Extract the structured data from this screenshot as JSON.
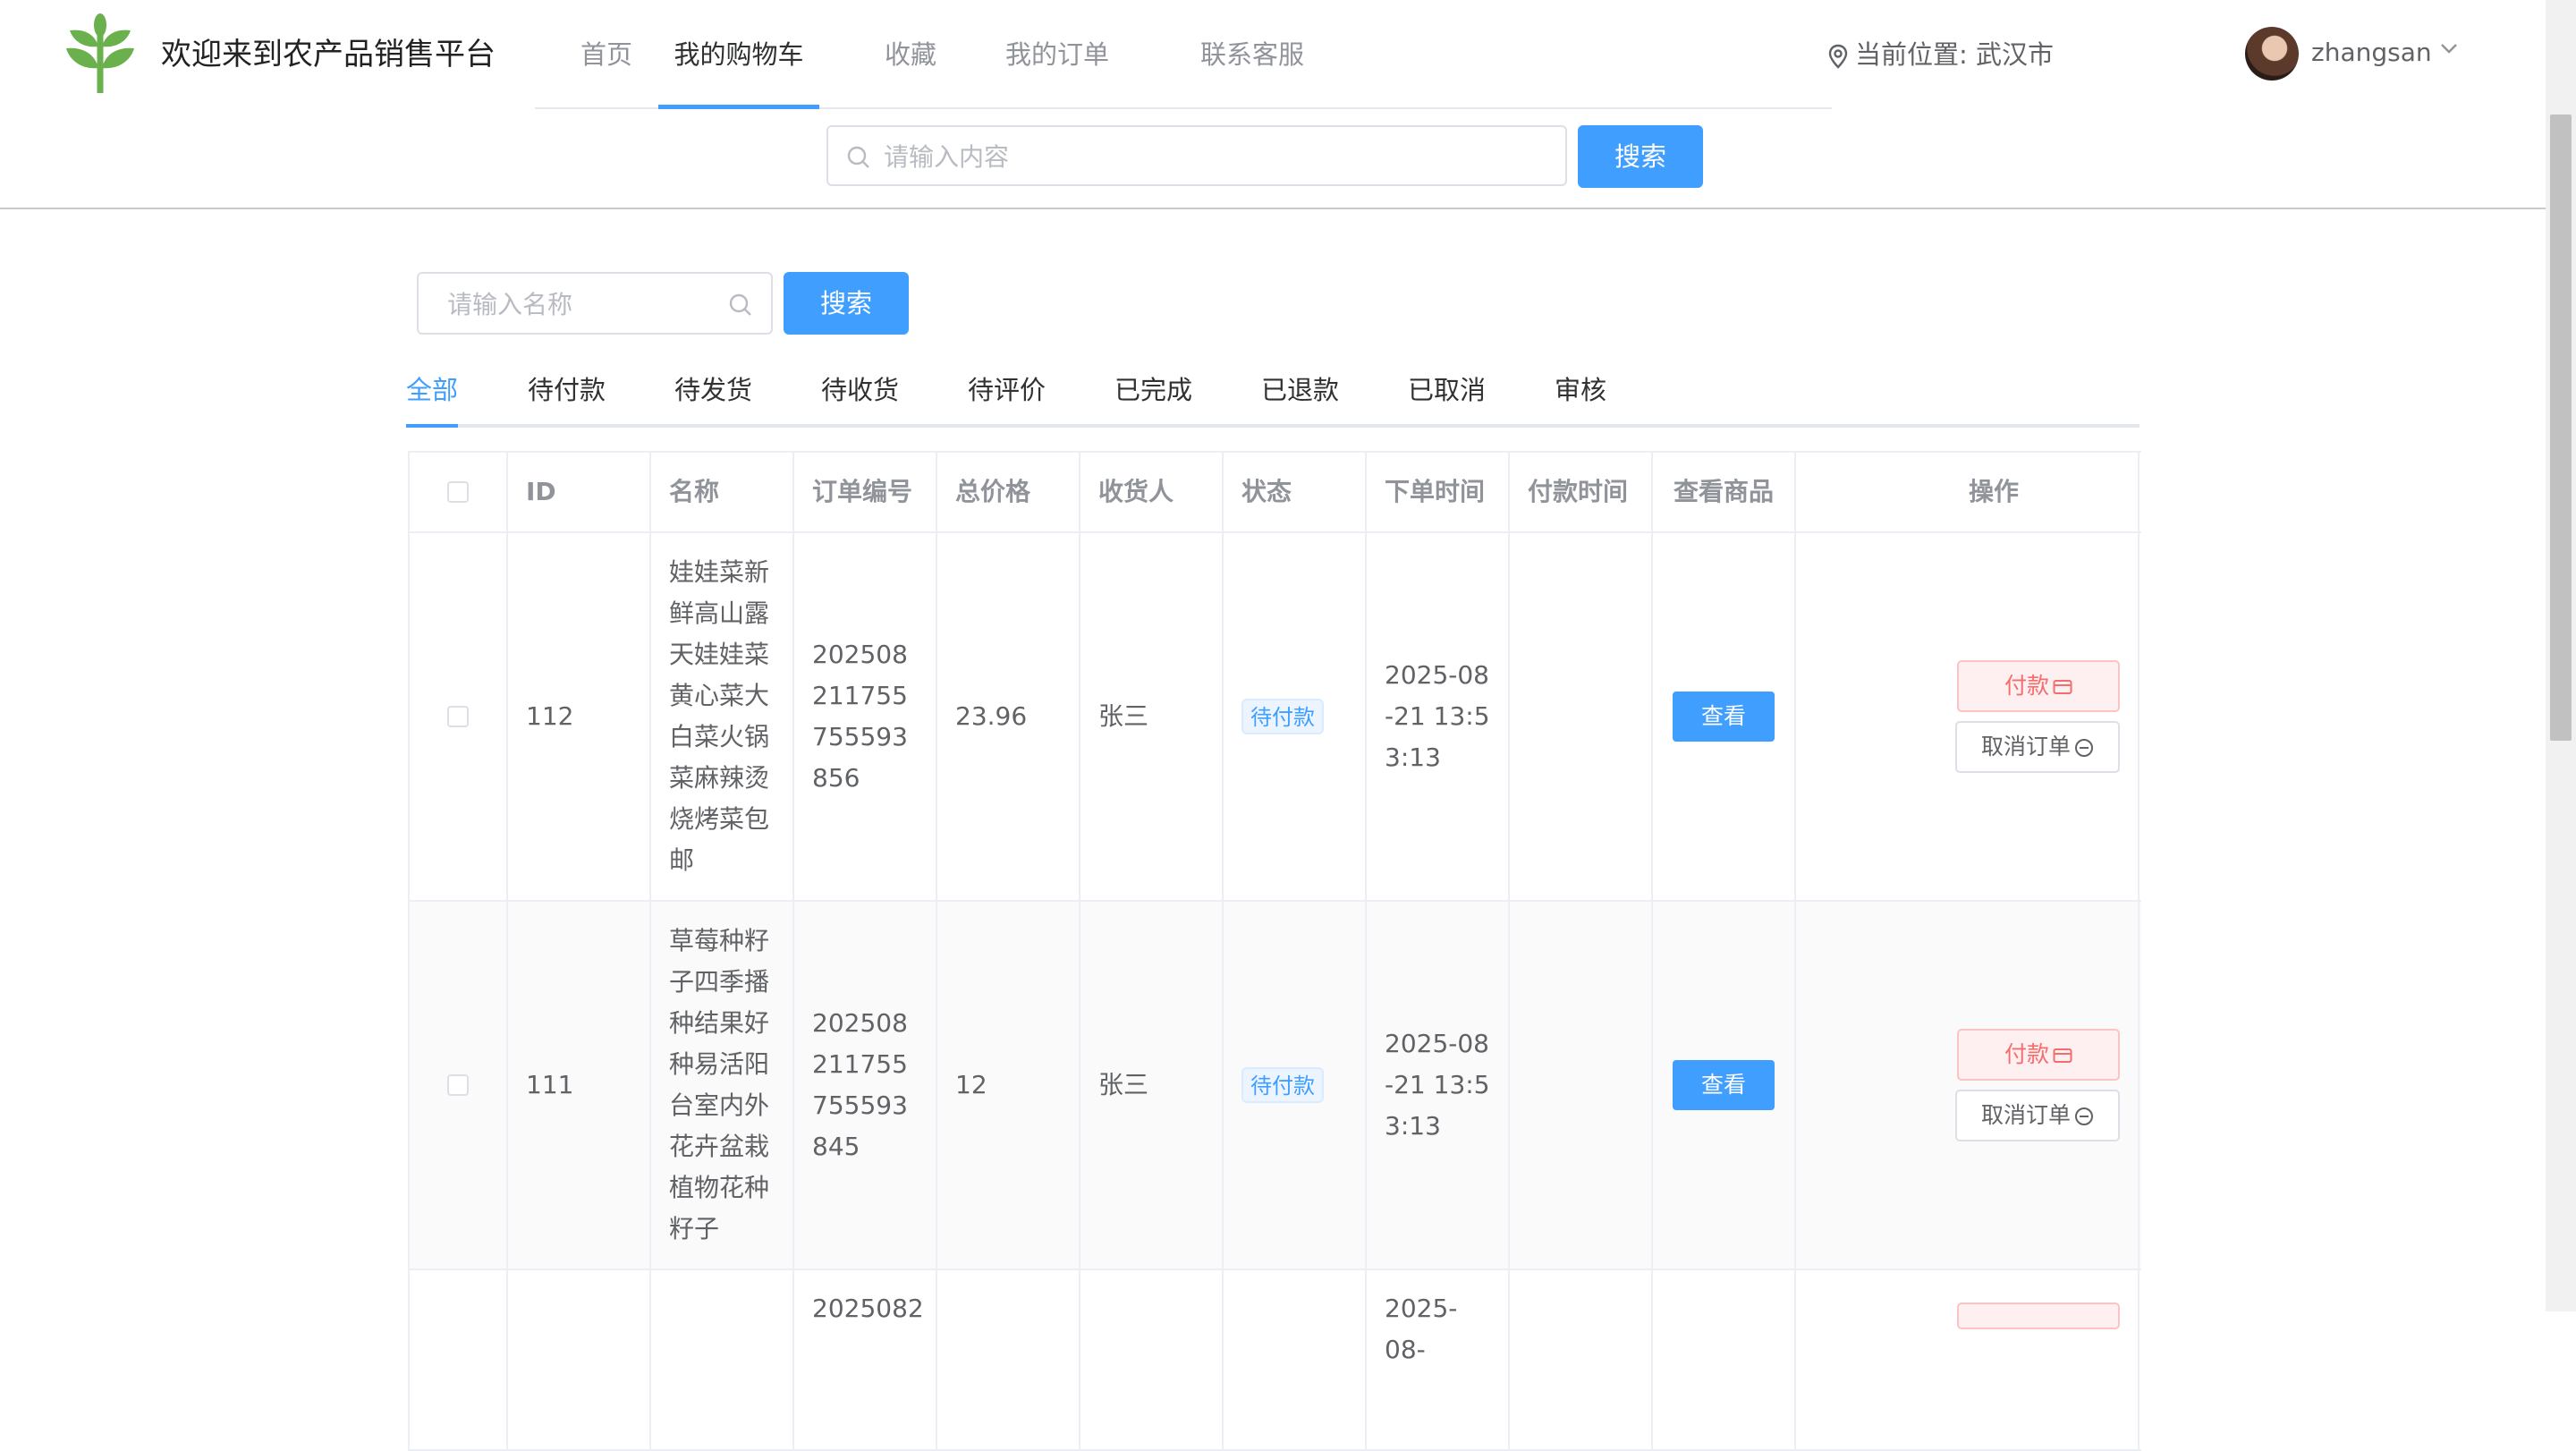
{
  "header": {
    "site_title": "欢迎来到农产品销售平台",
    "nav": [
      {
        "label": "首页",
        "active": false
      },
      {
        "label": "我的购物车",
        "active": true
      },
      {
        "label": "收藏",
        "active": false
      },
      {
        "label": "我的订单",
        "active": false
      },
      {
        "label": "联系客服",
        "active": false
      }
    ],
    "location_label": "当前位置: 武汉市",
    "username": "zhangsan",
    "search_placeholder": "请输入内容",
    "search_button": "搜索"
  },
  "filter": {
    "name_placeholder": "请输入名称",
    "search_button": "搜索"
  },
  "tabs": [
    {
      "label": "全部",
      "active": true
    },
    {
      "label": "待付款",
      "active": false
    },
    {
      "label": "待发货",
      "active": false
    },
    {
      "label": "待收货",
      "active": false
    },
    {
      "label": "待评价",
      "active": false
    },
    {
      "label": "已完成",
      "active": false
    },
    {
      "label": "已退款",
      "active": false
    },
    {
      "label": "已取消",
      "active": false
    },
    {
      "label": "审核",
      "active": false
    }
  ],
  "table": {
    "columns": [
      "ID",
      "名称",
      "订单编号",
      "总价格",
      "收货人",
      "状态",
      "下单时间",
      "付款时间",
      "查看商品",
      "操作"
    ],
    "rows": [
      {
        "id": "112",
        "name": "娃娃菜新鲜高山露天娃娃菜黄心菜大白菜火锅菜麻辣烫烧烤菜包邮",
        "order_no": "202508211755755593856",
        "total": "23.96",
        "receiver": "张三",
        "status": "待付款",
        "order_time": "2025-08-21 13:53:13",
        "pay_time": "",
        "view_label": "查看",
        "pay_label": "付款",
        "cancel_label": "取消订单"
      },
      {
        "id": "111",
        "name": "草莓种籽子四季播种结果好种易活阳台室内外花卉盆栽植物花种籽子",
        "order_no": "202508211755755593845",
        "total": "12",
        "receiver": "张三",
        "status": "待付款",
        "order_time": "2025-08-21 13:53:13",
        "pay_time": "",
        "view_label": "查看",
        "pay_label": "付款",
        "cancel_label": "取消订单"
      },
      {
        "id": "",
        "name": "",
        "order_no": "2025082",
        "total": "",
        "receiver": "",
        "status": "",
        "order_time": "2025-08-",
        "pay_time": "",
        "view_label": "",
        "pay_label": "",
        "cancel_label": ""
      }
    ]
  },
  "colors": {
    "primary": "#409eff",
    "danger": "#f56c6c",
    "brand_green": "#6ab04c"
  },
  "icons": {
    "logo": "sprout-logo",
    "location": "location-pin-icon",
    "search": "search-icon",
    "dropdown": "chevron-down-icon",
    "pay": "credit-card-icon",
    "cancel": "minus-circle-icon"
  }
}
